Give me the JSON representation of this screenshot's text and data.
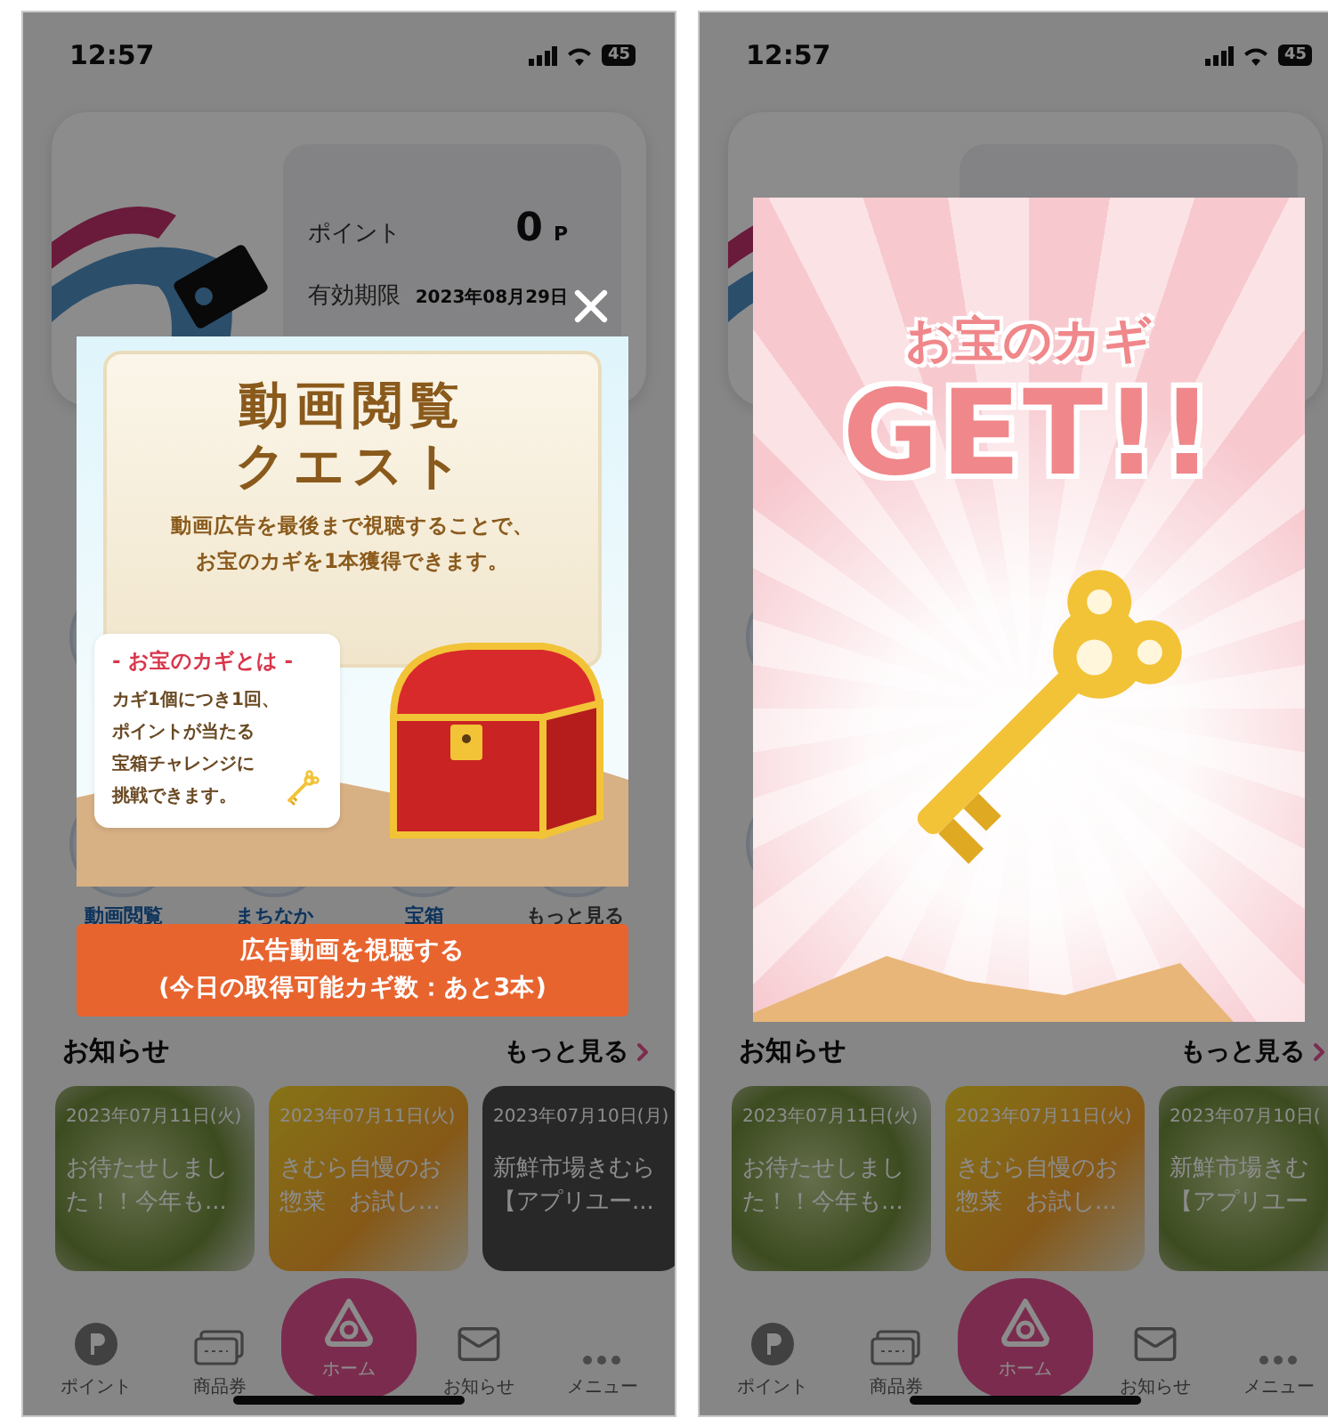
{
  "screens": [
    {
      "status_bar": {
        "time": "12:57",
        "battery": "45"
      },
      "point_card": {
        "rows": [
          {
            "label": "ポイント",
            "value": "0",
            "unit": "P"
          },
          {
            "label": "有効期限",
            "value": "2023年08月29日"
          }
        ]
      },
      "menu": [
        {
          "label": "動画閲覧",
          "kind": "link"
        },
        {
          "label": "まちなか",
          "kind": "link"
        },
        {
          "label": "宝箱",
          "kind": "link"
        },
        {
          "label": "もっと見る",
          "kind": "more"
        }
      ],
      "news": {
        "title": "お知らせ",
        "more": "もっと見る",
        "items": [
          {
            "kind": "photo",
            "date": "2023年07月11日(火)",
            "lines": [
              "お待たせしまし",
              "た！！今年も..."
            ]
          },
          {
            "kind": "flyer",
            "date": "2023年07月11日(火)",
            "lines": [
              "きむら自慢のお",
              "惣菜　お試し..."
            ]
          },
          {
            "kind": "text",
            "date": "2023年07月10日(月)",
            "lines": [
              "新鮮市場きむら",
              "【アプリユー..."
            ]
          }
        ]
      },
      "tab_bar": [
        {
          "label": "ポイント",
          "selected": false
        },
        {
          "label": "商品券",
          "selected": false
        },
        {
          "label": "ホーム",
          "selected": true
        },
        {
          "label": "お知らせ",
          "selected": false
        },
        {
          "label": "メニュー",
          "selected": false
        }
      ],
      "modal": {
        "kind": "quest",
        "title_lines": [
          "動画閲覧",
          "クエスト"
        ],
        "description_lines": [
          "動画広告を最後まで視聴することで、",
          "お宝のカギを1本獲得できます。"
        ],
        "info": {
          "heading": "- お宝のカギとは -",
          "lines": [
            "カギ1個につき1回、",
            "ポイントが当たる",
            "宝箱チャレンジに",
            "挑戦できます。"
          ]
        },
        "action_lines": [
          "広告動画を視聴する",
          "(今日の取得可能カギ数：あと3本)"
        ]
      }
    },
    {
      "status_bar": {
        "time": "12:57",
        "battery": "45"
      },
      "news": {
        "title": "お知らせ",
        "more": "もっと見る",
        "items": [
          {
            "kind": "photo",
            "date": "2023年07月11日(火)",
            "lines": [
              "お待たせしまし",
              "た！！今年も..."
            ]
          },
          {
            "kind": "flyer",
            "date": "2023年07月11日(火)",
            "lines": [
              "きむら自慢のお",
              "惣菜　お試し..."
            ]
          },
          {
            "kind": "photo",
            "date": "2023年07月10日(",
            "lines": [
              "新鮮市場きむ",
              "【アプリユー"
            ]
          }
        ]
      },
      "tab_bar": [
        {
          "label": "ポイント",
          "selected": false
        },
        {
          "label": "商品券",
          "selected": false
        },
        {
          "label": "ホーム",
          "selected": true
        },
        {
          "label": "お知らせ",
          "selected": false
        },
        {
          "label": "メニュー",
          "selected": false
        }
      ],
      "modal": {
        "kind": "reward",
        "subtitle": "お宝のカギ",
        "title": "GET!!"
      }
    }
  ]
}
